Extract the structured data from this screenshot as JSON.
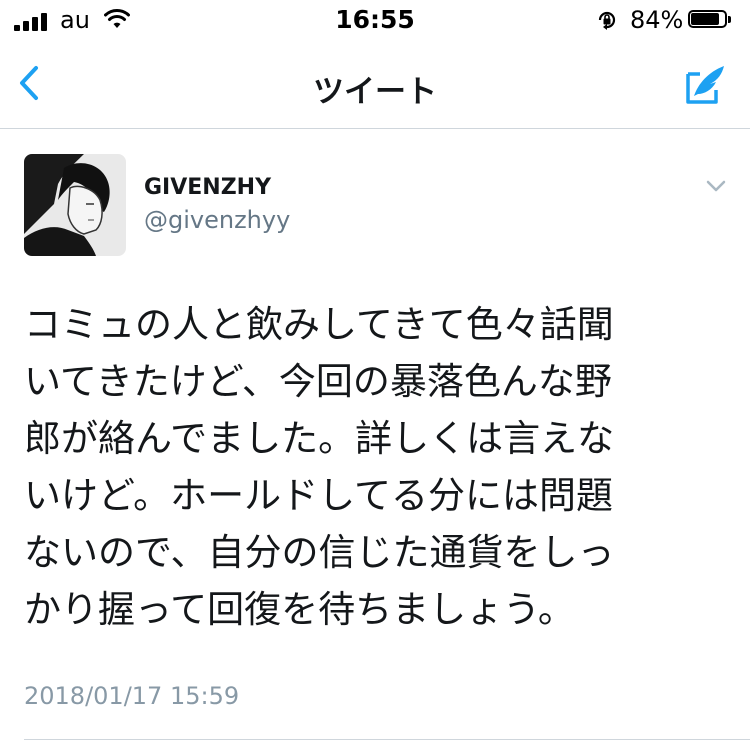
{
  "status_bar": {
    "carrier": "au",
    "time": "16:55",
    "battery_percent": "84%",
    "battery_level": 0.84,
    "icons": [
      "signal-icon",
      "wifi-icon",
      "rotation-lock-icon",
      "battery-icon"
    ]
  },
  "nav": {
    "title": "ツイート",
    "back_icon": "chevron-left-icon",
    "compose_icon": "compose-tweet-icon",
    "accent_color": "#1da1f2"
  },
  "tweet": {
    "display_name": "GIVENZHY",
    "handle": "@givenzhyy",
    "text": "コミュの人と飲みしてきて色々話聞\nいてきたけど、今回の暴落色んな野\n郎が絡んでました。詳しくは言えな\nいけど。ホールドしてる分には問題\nないので、自分の信じた通貨をしっ\nかり握って回復を待ちましょう。",
    "timestamp": "2018/01/17 15:59",
    "menu_icon": "chevron-down-icon"
  }
}
